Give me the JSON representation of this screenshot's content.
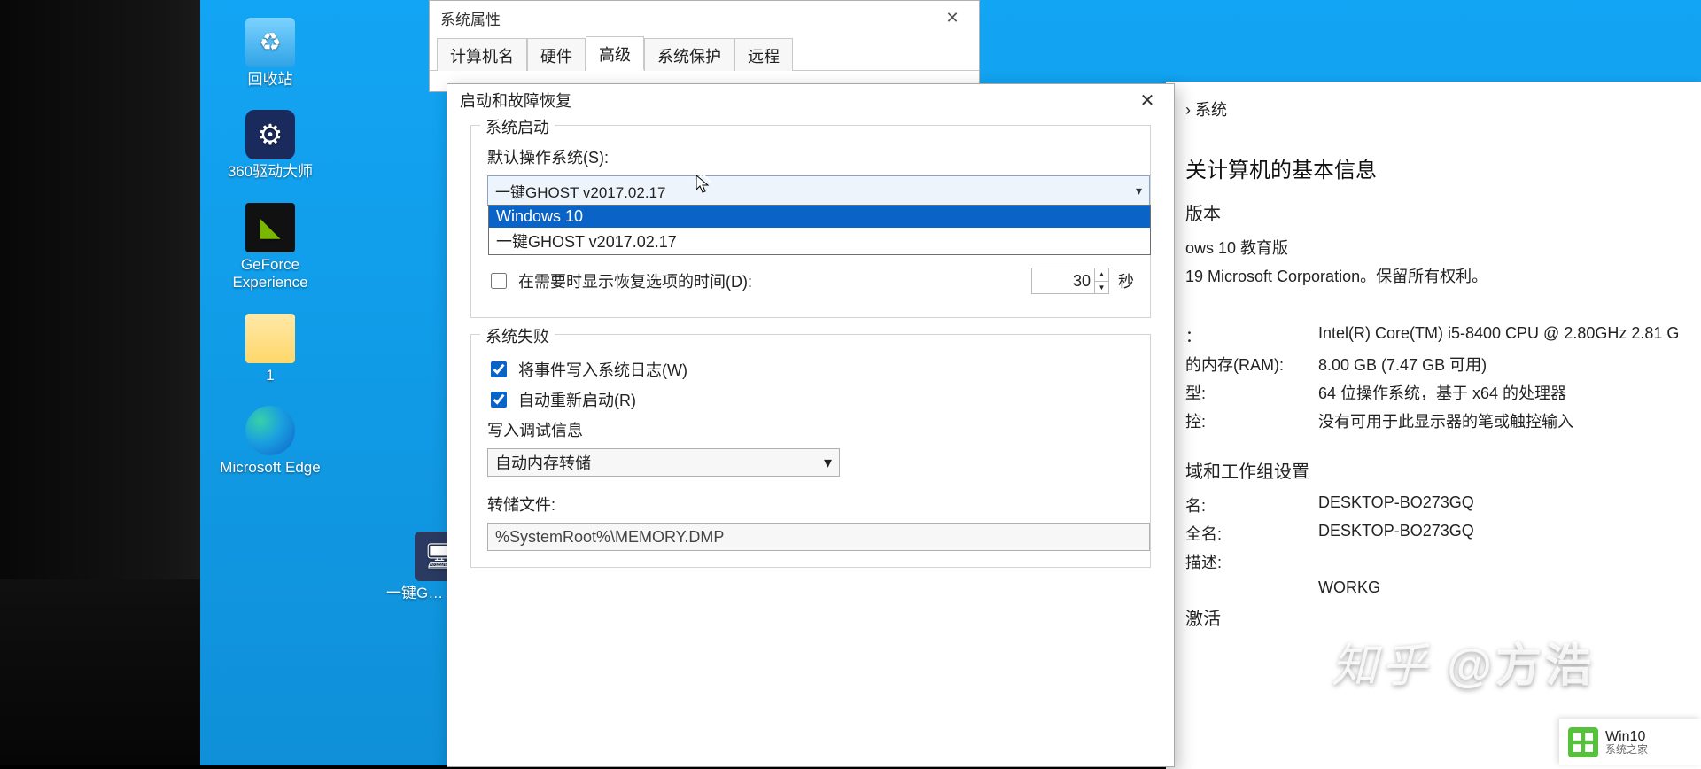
{
  "desktop": {
    "icons_col1": [
      {
        "name": "recycle-bin",
        "label": "回收站",
        "glyph": "recycle"
      },
      {
        "name": "360-driver",
        "label": "360驱动大师",
        "glyph": "driver"
      },
      {
        "name": "geforce",
        "label": "GeForce Experience",
        "glyph": "geforce"
      },
      {
        "name": "folder-1",
        "label": "1",
        "glyph": "folder"
      },
      {
        "name": "edge",
        "label": "Microsoft Edge",
        "glyph": "edge"
      }
    ],
    "icons_col2": [
      {
        "name": "ghost",
        "label": "一键G… 硬盘…",
        "glyph": "ghost"
      }
    ]
  },
  "syswin": {
    "breadcrumb_tail": "› 系统",
    "heading": "关计算机的基本信息",
    "sec_version": "版本",
    "edition": "ows 10 教育版",
    "copyright": "19 Microsoft Corporation。保留所有权利。",
    "rows": [
      {
        "k": "：",
        "v": "Intel(R) Core(TM) i5-8400 CPU @ 2.80GHz  2.81 G"
      },
      {
        "k": "的内存(RAM):",
        "v": "8.00 GB (7.47 GB 可用)"
      },
      {
        "k": "型:",
        "v": "64 位操作系统，基于 x64 的处理器"
      },
      {
        "k": "控:",
        "v": "没有可用于此显示器的笔或触控输入"
      }
    ],
    "sec_domain": "域和工作组设置",
    "rows2": [
      {
        "k": "名:",
        "v": "DESKTOP-BO273GQ"
      },
      {
        "k": "全名:",
        "v": "DESKTOP-BO273GQ"
      },
      {
        "k": "描述:",
        "v": ""
      },
      {
        "k": "",
        "v": "WORKG"
      }
    ],
    "sec_act": "激活"
  },
  "propdlg": {
    "title": "系统属性",
    "tabs": [
      "计算机名",
      "硬件",
      "高级",
      "系统保护",
      "远程"
    ],
    "active_tab_index": 2
  },
  "startdlg": {
    "title": "启动和故障恢复",
    "group_startup": "系统启动",
    "label_default_os": "默认操作系统(S):",
    "select_value": "一键GHOST v2017.02.17",
    "dropdown": [
      "Windows 10",
      "一键GHOST v2017.02.17"
    ],
    "dropdown_selected_index": 0,
    "check_recovery_time": "在需要时显示恢复选项的时间(D):",
    "recovery_secs": "30",
    "secs_unit": "秒",
    "group_failure": "系统失败",
    "check_writelog": "将事件写入系统日志(W)",
    "check_autoreboot": "自动重新启动(R)",
    "label_debuginfo": "写入调试信息",
    "debug_select": "自动内存转储",
    "label_dumpfile": "转储文件:",
    "dumpfile": "%SystemRoot%\\MEMORY.DMP"
  },
  "watermark": {
    "brand": "知乎",
    "at": "@方浩"
  },
  "badge": {
    "line1": "Win10",
    "line2": "系统之家"
  }
}
